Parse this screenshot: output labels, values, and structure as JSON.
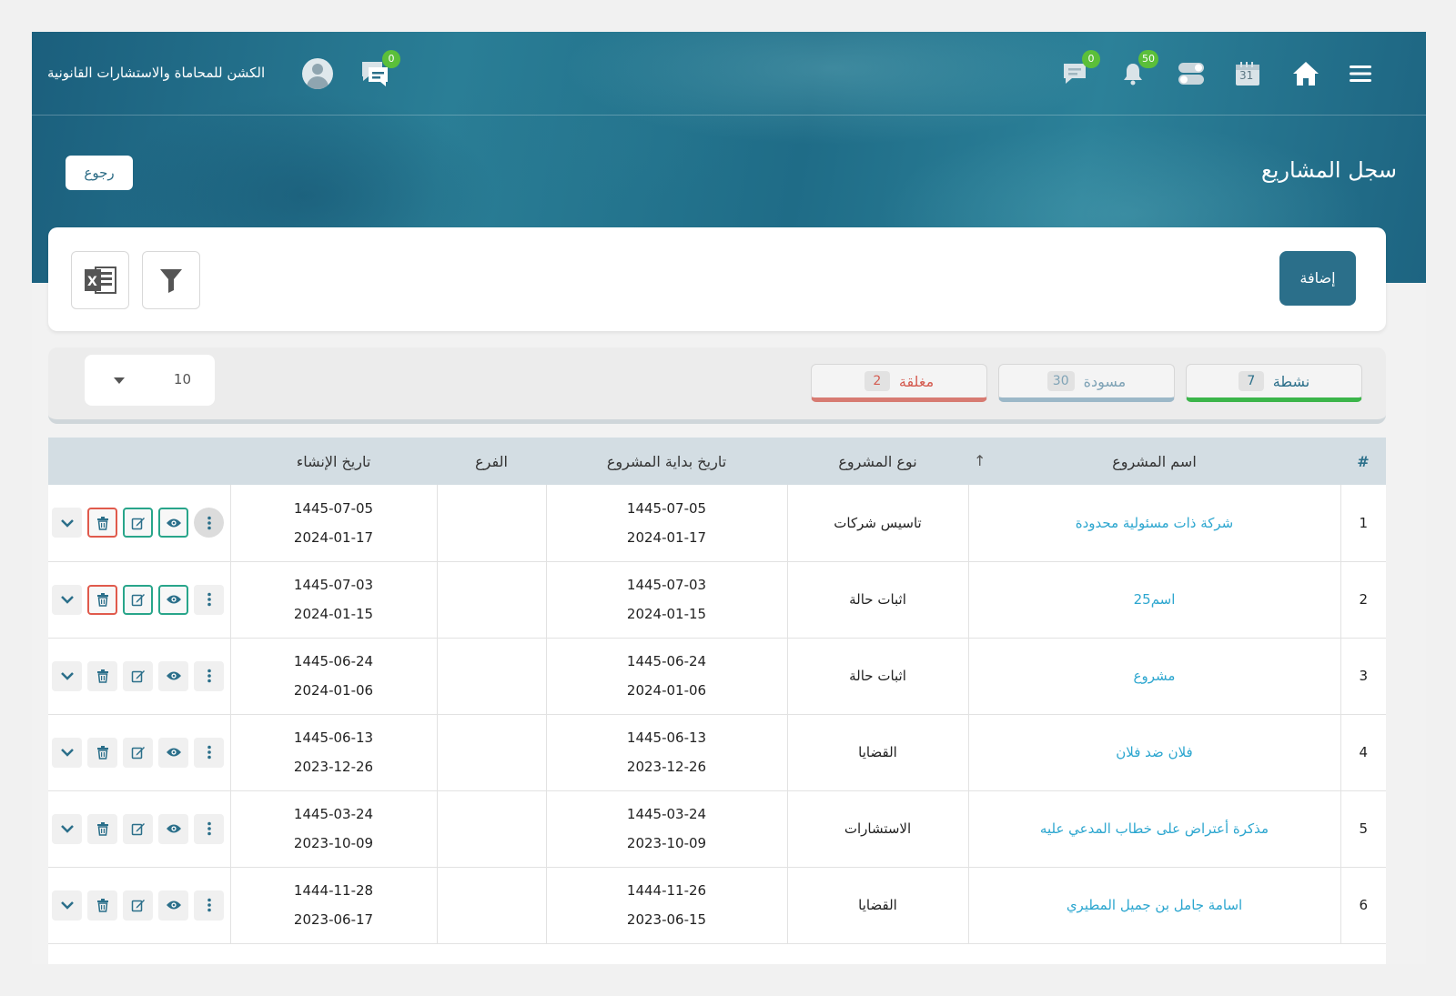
{
  "header": {
    "firm_name": "الكشن للمحاماة والاستشارات القانونية",
    "chat_badge": "0",
    "messages_badge": "0",
    "notifications_badge": "50",
    "calendar_day": "31"
  },
  "page": {
    "title": "سجل المشاريع",
    "back_label": "رجوع",
    "add_label": "إضافة"
  },
  "filters": {
    "page_size": "10",
    "tabs": [
      {
        "label": "نشطة",
        "count": "7",
        "color": "#3bb54a",
        "text_color": "#2b6f8a"
      },
      {
        "label": "مسودة",
        "count": "30",
        "color": "#9cb8c8",
        "text_color": "#7fa3b6"
      },
      {
        "label": "مغلقة",
        "count": "2",
        "color": "#d77b72",
        "text_color": "#d45b50"
      }
    ]
  },
  "table": {
    "columns": {
      "index": "#",
      "name": "اسم المشروع",
      "sort_icon": "↑",
      "type": "نوع المشروع",
      "start_date": "تاريخ بداية المشروع",
      "branch": "الفرع",
      "created": "تاريخ الإنشاء"
    },
    "rows": [
      {
        "idx": "1",
        "name": "شركة ذات مسئولية محدودة",
        "type": "تاسيس شركات",
        "start_h": "1445-07-05",
        "start_g": "2024-01-17",
        "branch": "",
        "created_h": "1445-07-05",
        "created_g": "2024-01-17"
      },
      {
        "idx": "2",
        "name": "اسم25",
        "type": "اثبات حالة",
        "start_h": "1445-07-03",
        "start_g": "2024-01-15",
        "branch": "",
        "created_h": "1445-07-03",
        "created_g": "2024-01-15"
      },
      {
        "idx": "3",
        "name": "مشروع",
        "type": "اثبات حالة",
        "start_h": "1445-06-24",
        "start_g": "2024-01-06",
        "branch": "",
        "created_h": "1445-06-24",
        "created_g": "2024-01-06"
      },
      {
        "idx": "4",
        "name": "فلان ضد فلان",
        "type": "القضايا",
        "start_h": "1445-06-13",
        "start_g": "2023-12-26",
        "branch": "",
        "created_h": "1445-06-13",
        "created_g": "2023-12-26"
      },
      {
        "idx": "5",
        "name": "مذكرة أعتراض على خطاب المدعي عليه",
        "type": "الاستشارات",
        "start_h": "1445-03-24",
        "start_g": "2023-10-09",
        "branch": "",
        "created_h": "1445-03-24",
        "created_g": "2023-10-09"
      },
      {
        "idx": "6",
        "name": "اسامة جامل بن جميل المطيري",
        "type": "القضايا",
        "start_h": "1444-11-26",
        "start_g": "2023-06-15",
        "branch": "",
        "created_h": "1444-11-28",
        "created_g": "2023-06-17"
      }
    ]
  }
}
